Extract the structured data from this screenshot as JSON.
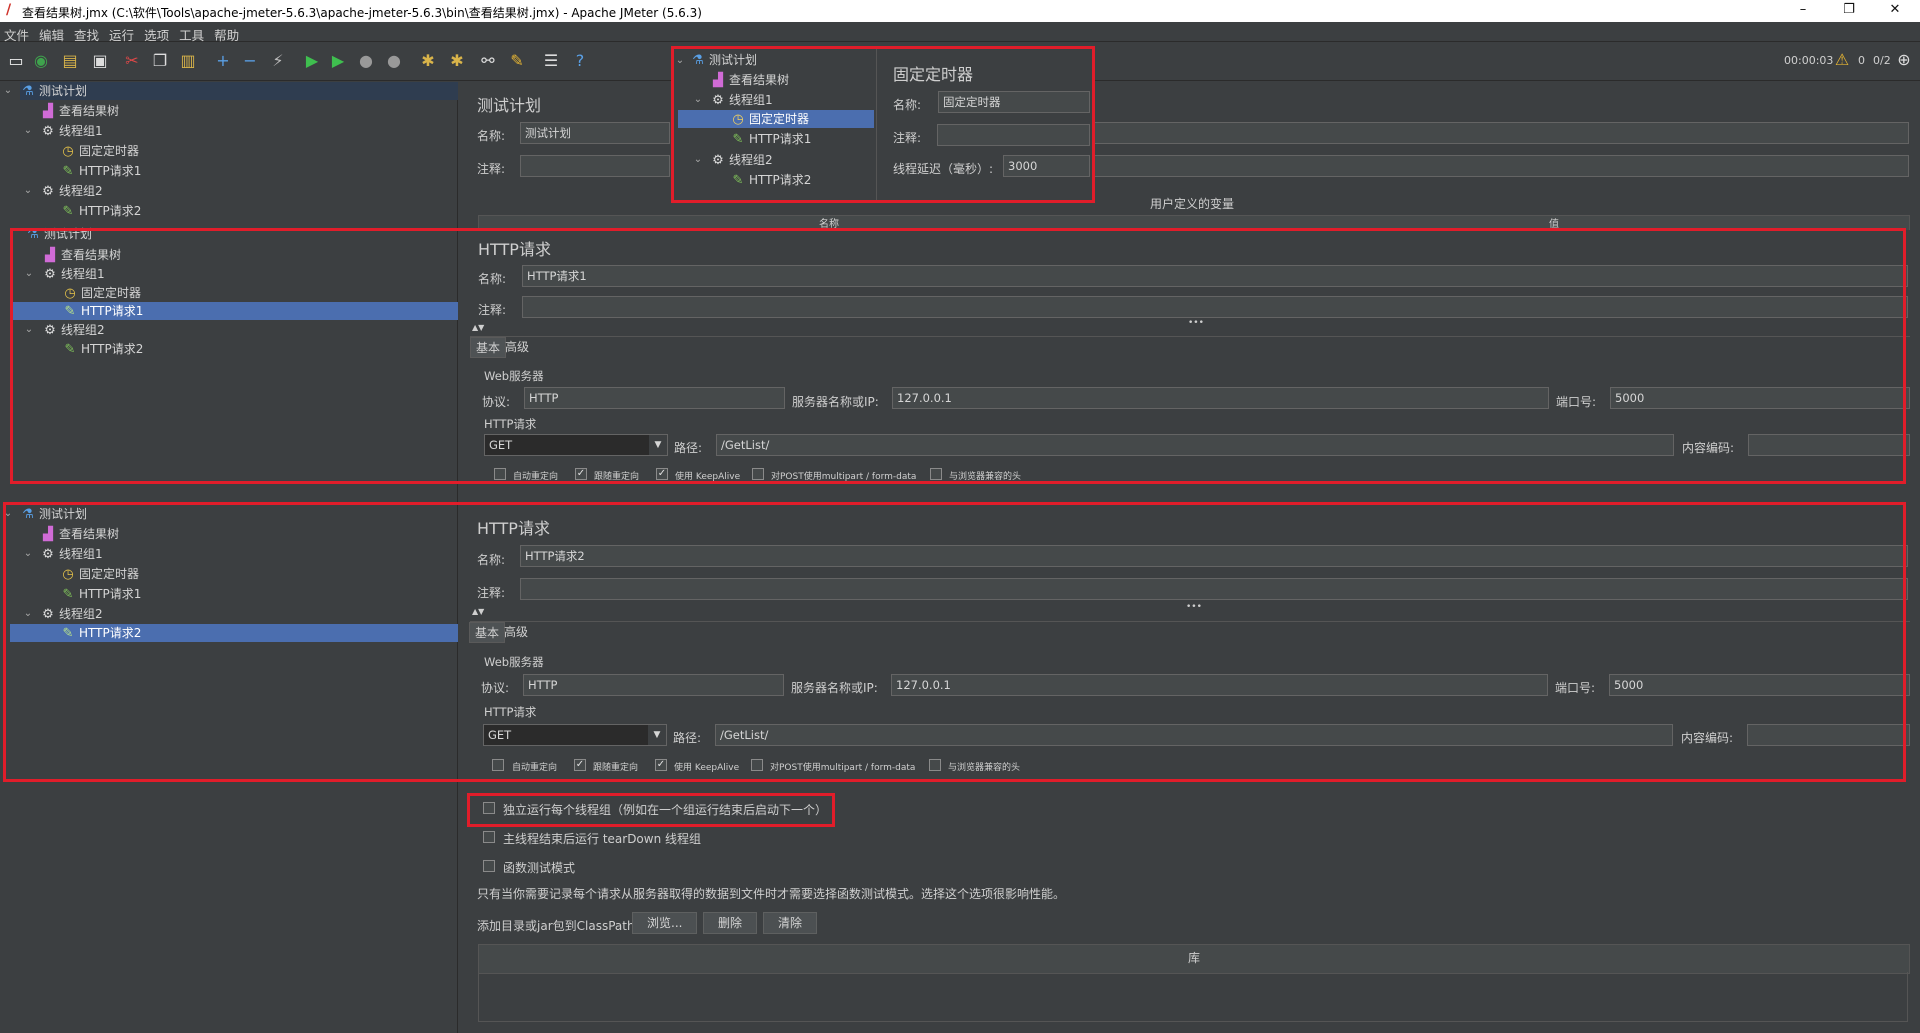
{
  "window": {
    "title": "查看结果树.jmx (C:\\软件\\Tools\\apache-jmeter-5.6.3\\apache-jmeter-5.6.3\\bin\\查看结果树.jmx) - Apache JMeter (5.6.3)",
    "minimize": "–",
    "maximize": "❐",
    "close": "✕"
  },
  "menu": [
    "文件",
    "编辑",
    "查找",
    "运行",
    "选项",
    "工具",
    "帮助"
  ],
  "toolbar_status": {
    "time": "00:00:03",
    "warnings": "0",
    "threads": "0/2"
  },
  "tree": {
    "test_plan": "测试计划",
    "results_tree": "查看结果树",
    "thread_group_1": "线程组1",
    "timer": "固定定时器",
    "http_1": "HTTP请求1",
    "thread_group_2": "线程组2",
    "http_2": "HTTP请求2"
  },
  "test_plan_panel": {
    "title": "测试计划",
    "name_label": "名称:",
    "name_value": "测试计划",
    "comment_label": "注释:",
    "user_vars_title": "用户定义的变量",
    "col_name": "名称",
    "col_value": "值",
    "independent_tg": "独立运行每个线程组（例如在一个组运行结束后启动下一个）",
    "teardown": "主线程结束后运行 tearDown 线程组",
    "functional_mode": "函数测试模式",
    "functional_note": "只有当你需要记录每个请求从服务器取得的数据到文件时才需要选择函数测试模式。选择这个选项很影响性能。",
    "classpath_label": "添加目录或jar包到ClassPath",
    "browse": "浏览...",
    "delete": "删除",
    "clear": "清除",
    "library": "库"
  },
  "timer_panel": {
    "title": "固定定时器",
    "name_label": "名称:",
    "name_value": "固定定时器",
    "comment_label": "注释:",
    "delay_label": "线程延迟（毫秒）:",
    "delay_value": "3000"
  },
  "http1": {
    "title": "HTTP请求",
    "name_label": "名称:",
    "name_value": "HTTP请求1",
    "comment_label": "注释:",
    "tab_basic": "基本",
    "tab_advanced": "高级",
    "web_server": "Web服务器",
    "protocol_label": "协议:",
    "protocol_value": "HTTP",
    "server_label": "服务器名称或IP:",
    "server_value": "127.0.0.1",
    "port_label": "端口号:",
    "port_value": "5000",
    "http_request": "HTTP请求",
    "method": "GET",
    "path_label": "路径:",
    "path_value": "/GetList/",
    "encoding_label": "内容编码:",
    "opt_redirect": "自动重定向",
    "opt_follow": "跟随重定向",
    "opt_keepalive": "使用 KeepAlive",
    "opt_multipart": "对POST使用multipart / form-data",
    "opt_browser": "与浏览器兼容的头"
  },
  "http2": {
    "title": "HTTP请求",
    "name_label": "名称:",
    "name_value": "HTTP请求2",
    "comment_label": "注释:",
    "tab_basic": "基本",
    "tab_advanced": "高级",
    "web_server": "Web服务器",
    "protocol_label": "协议:",
    "protocol_value": "HTTP",
    "server_label": "服务器名称或IP:",
    "server_value": "127.0.0.1",
    "port_label": "端口号:",
    "port_value": "5000",
    "http_request": "HTTP请求",
    "method": "GET",
    "path_label": "路径:",
    "path_value": "/GetList/",
    "encoding_label": "内容编码:",
    "opt_redirect": "自动重定向",
    "opt_follow": "跟随重定向",
    "opt_keepalive": "使用 KeepAlive",
    "opt_multipart": "对POST使用multipart / form-data",
    "opt_browser": "与浏览器兼容的头"
  },
  "colors": {
    "highlight": "#e11d2a",
    "selection": "#4b6eaf",
    "background": "#3c3f41"
  }
}
